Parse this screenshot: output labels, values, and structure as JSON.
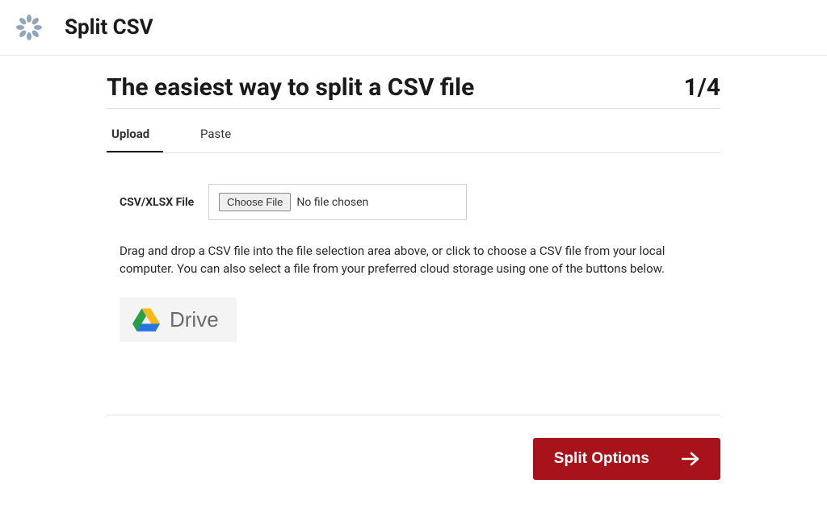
{
  "header": {
    "app_title": "Split CSV"
  },
  "main": {
    "heading": "The easiest way to split a CSV file",
    "step_counter": "1/4"
  },
  "tabs": {
    "upload": "Upload",
    "paste": "Paste",
    "active": "upload"
  },
  "form": {
    "file_label": "CSV/XLSX File",
    "choose_file_btn": "Choose File",
    "file_status": "No file chosen",
    "instructions": "Drag and drop a CSV file into the file selection area above, or click to choose a CSV file from your local computer. You can also select a file from your preferred cloud storage using one of the buttons below.",
    "drive_label": "Drive"
  },
  "footer": {
    "split_options_btn": "Split Options"
  }
}
